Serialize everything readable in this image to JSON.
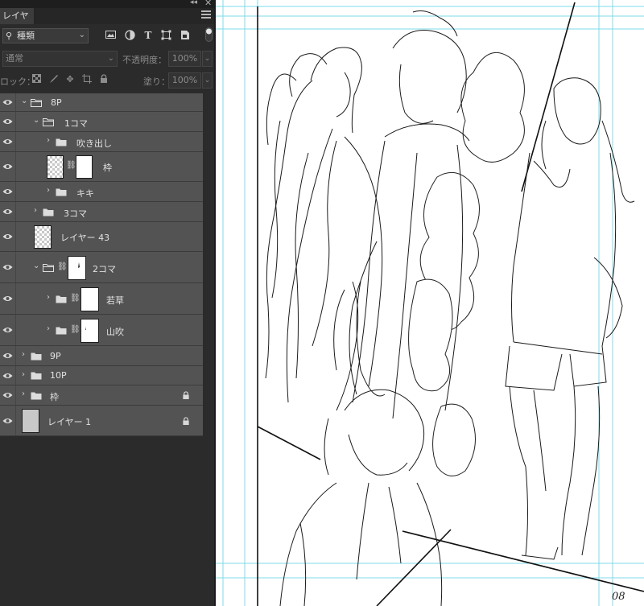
{
  "panel": {
    "tab_title": "レイヤー",
    "collapse_icon": "double-chevron-left",
    "close_icon": "close-x",
    "menu_icon": "hamburger"
  },
  "filter": {
    "kind_label": "種類",
    "icons": [
      "image-filter-icon",
      "adjustment-filter-icon",
      "type-filter-icon",
      "shape-filter-icon",
      "smart-object-filter-icon"
    ]
  },
  "blend": {
    "mode": "通常",
    "opacity_label": "不透明度：",
    "opacity_value": "100%"
  },
  "lock": {
    "label": "ロック：",
    "fill_label": "塗り：",
    "fill_value": "100%"
  },
  "layers": [
    {
      "name": "8P",
      "type": "group",
      "expanded": true
    },
    {
      "name": "1コマ",
      "type": "group",
      "expanded": true
    },
    {
      "name": "吹き出し",
      "type": "group",
      "expanded": false
    },
    {
      "name": "枠",
      "type": "layer-with-mask"
    },
    {
      "name": "キキ",
      "type": "group",
      "expanded": false
    },
    {
      "name": "3コマ",
      "type": "group",
      "expanded": false
    },
    {
      "name": "レイヤー 43",
      "type": "layer"
    },
    {
      "name": "2コマ",
      "type": "group-with-mask",
      "expanded": true
    },
    {
      "name": "若草",
      "type": "group-with-mask",
      "expanded": false
    },
    {
      "name": "山吹",
      "type": "group-with-mask",
      "expanded": false
    },
    {
      "name": "9P",
      "type": "group",
      "expanded": false
    },
    {
      "name": "10P",
      "type": "group",
      "expanded": false
    },
    {
      "name": "枠",
      "type": "group",
      "expanded": false,
      "locked": true
    },
    {
      "name": "レイヤー 1",
      "type": "layer",
      "locked": true
    }
  ],
  "canvas": {
    "page_number": "08",
    "guide_color": "#7fdbe9"
  }
}
